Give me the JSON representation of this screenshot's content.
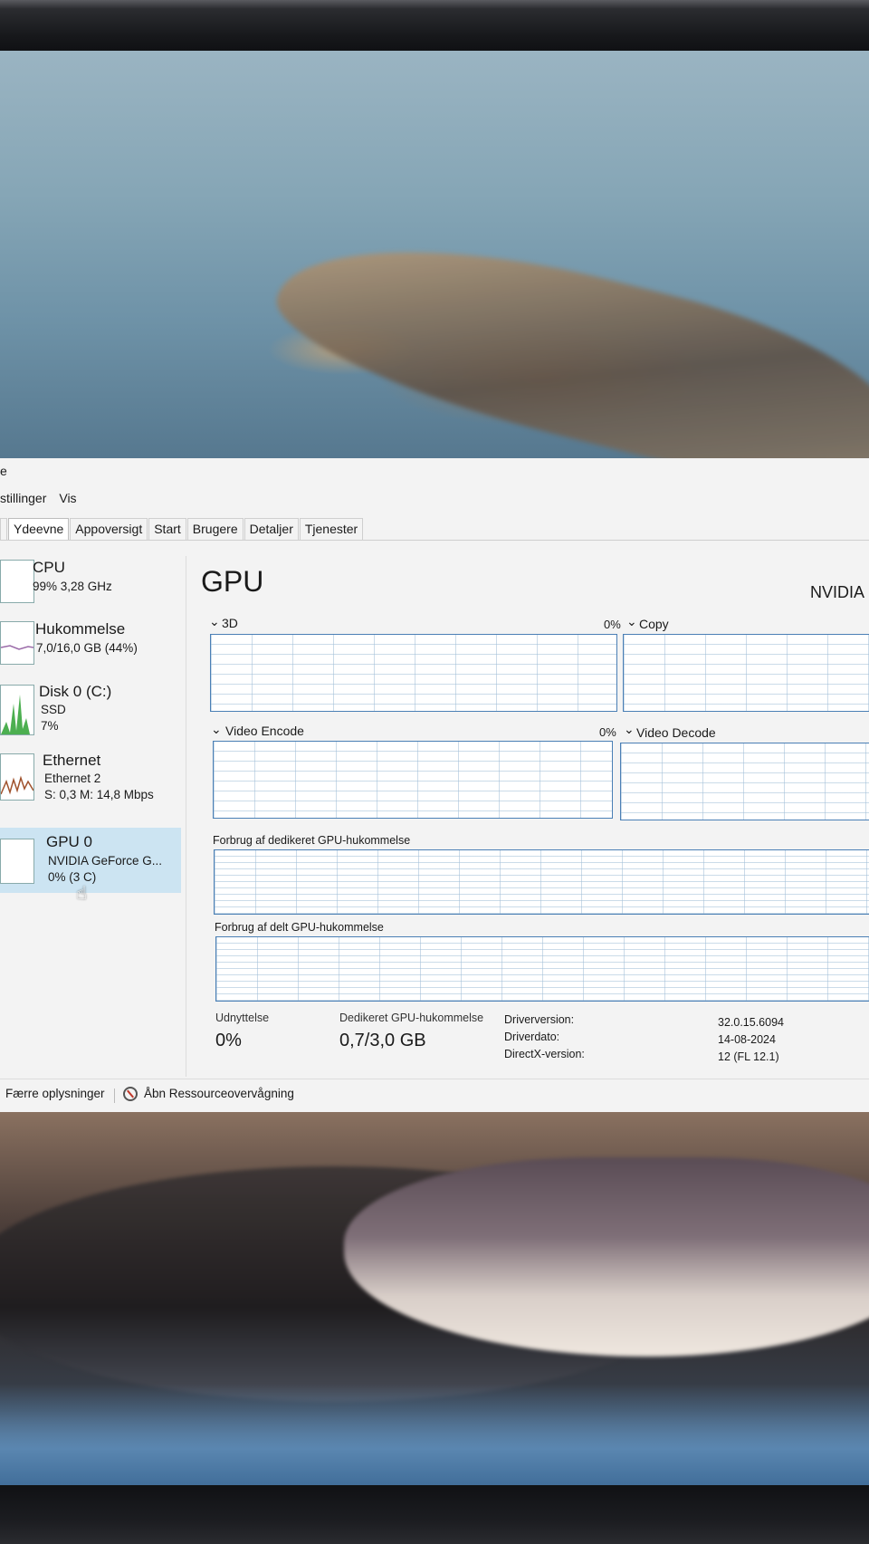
{
  "window": {
    "title_fragment": "e"
  },
  "menu": {
    "items": [
      "stillinger",
      "Vis"
    ]
  },
  "tabs": [
    "Ydeevne",
    "Appoversigt",
    "Start",
    "Brugere",
    "Detaljer",
    "Tjenester"
  ],
  "sidebar": {
    "items": [
      {
        "name": "CPU",
        "line1": "99% 3,28 GHz",
        "line2": ""
      },
      {
        "name": "Hukommelse",
        "line1": "7,0/16,0 GB (44%)",
        "line2": ""
      },
      {
        "name": "Disk 0 (C:)",
        "line1": "SSD",
        "line2": "7%"
      },
      {
        "name": "Ethernet",
        "line1": "Ethernet 2",
        "line2": "S: 0,3 M: 14,8 Mbps"
      },
      {
        "name": "GPU 0",
        "line1": "NVIDIA GeForce G...",
        "line2": "0% (3  C)"
      }
    ]
  },
  "gpu": {
    "title": "GPU",
    "brand": "NVIDIA",
    "engines": [
      {
        "label": "3D",
        "pct": "0%"
      },
      {
        "label": "Copy",
        "pct": ""
      },
      {
        "label": "Video Encode",
        "pct": "0%"
      },
      {
        "label": "Video Decode",
        "pct": ""
      }
    ],
    "dedicated_label": "Forbrug af dedikeret GPU-hukommelse",
    "shared_label": "Forbrug af delt GPU-hukommelse",
    "stats": {
      "util_label": "Udnyttelse",
      "util_value": "0%",
      "ded_label": "Dedikeret GPU-hukommelse",
      "ded_value": "0,7/3,0 GB"
    },
    "driver": {
      "version_label": "Driverversion:",
      "version_value": "32.0.15.6094",
      "date_label": "Driverdato:",
      "date_value": "14-08-2024",
      "dx_label": "DirectX-version:",
      "dx_value": "12 (FL 12.1)"
    }
  },
  "footer": {
    "fewer_label": "Færre oplysninger",
    "resmon_label": "Åbn Ressourceovervågning"
  },
  "colors": {
    "accent": "#4a7fb5",
    "selected": "#cce4f2",
    "bg": "#f3f3f3"
  },
  "icons": [
    "chevron-down-icon",
    "resource-monitor-icon",
    "mouse-pointer-icon"
  ]
}
